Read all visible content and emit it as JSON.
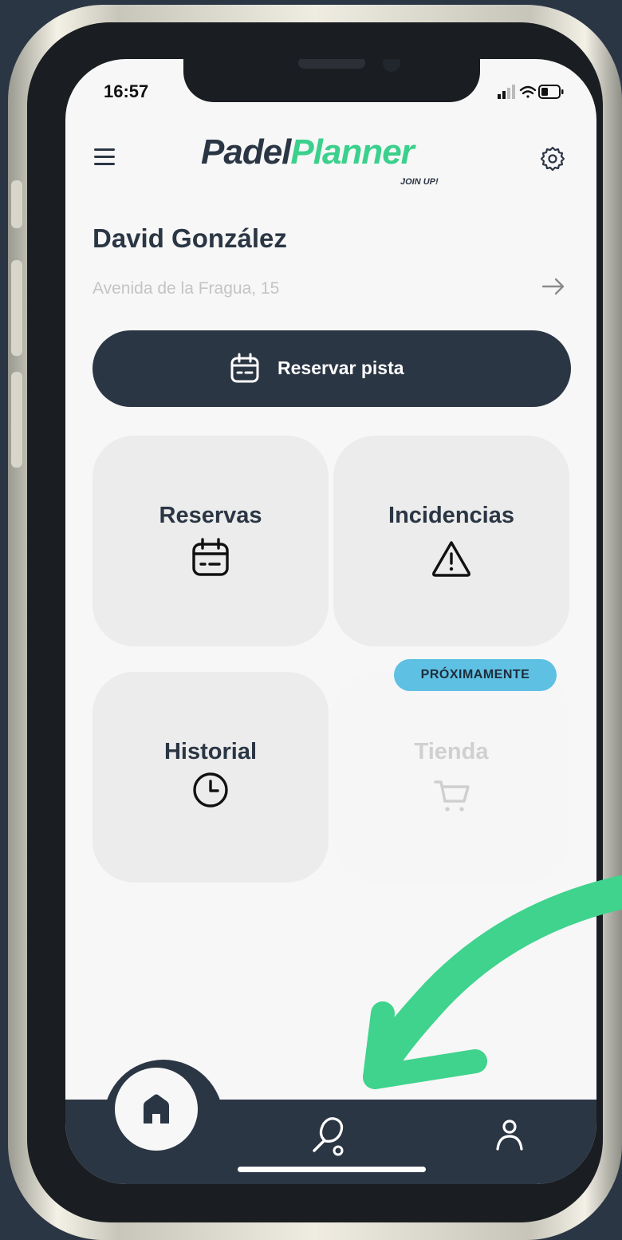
{
  "status_bar": {
    "time": "16:57"
  },
  "header": {
    "logo_part1": "Padel",
    "logo_part2": "Planner",
    "logo_tagline": "JOIN UP!"
  },
  "user": {
    "name": "David González",
    "address": "Avenida de la Fragua, 15"
  },
  "reserve_button": {
    "label": "Reservar pista"
  },
  "cards": [
    {
      "title": "Reservas",
      "icon": "calendar-icon"
    },
    {
      "title": "Incidencias",
      "icon": "warning-icon"
    },
    {
      "title": "Historial",
      "icon": "clock-icon"
    },
    {
      "title": "Tienda",
      "icon": "cart-icon",
      "badge": "PRÓXIMAMENTE"
    }
  ],
  "bottom_nav": [
    {
      "name": "home",
      "icon": "home-icon",
      "active": true
    },
    {
      "name": "padel",
      "icon": "padel-racket-icon"
    },
    {
      "name": "profile",
      "icon": "user-icon"
    }
  ],
  "colors": {
    "primary": "#2b3644",
    "accent": "#3bd08c",
    "badge": "#5ec0e3",
    "card": "#ececec",
    "annotation_arrow": "#3fd38d"
  }
}
